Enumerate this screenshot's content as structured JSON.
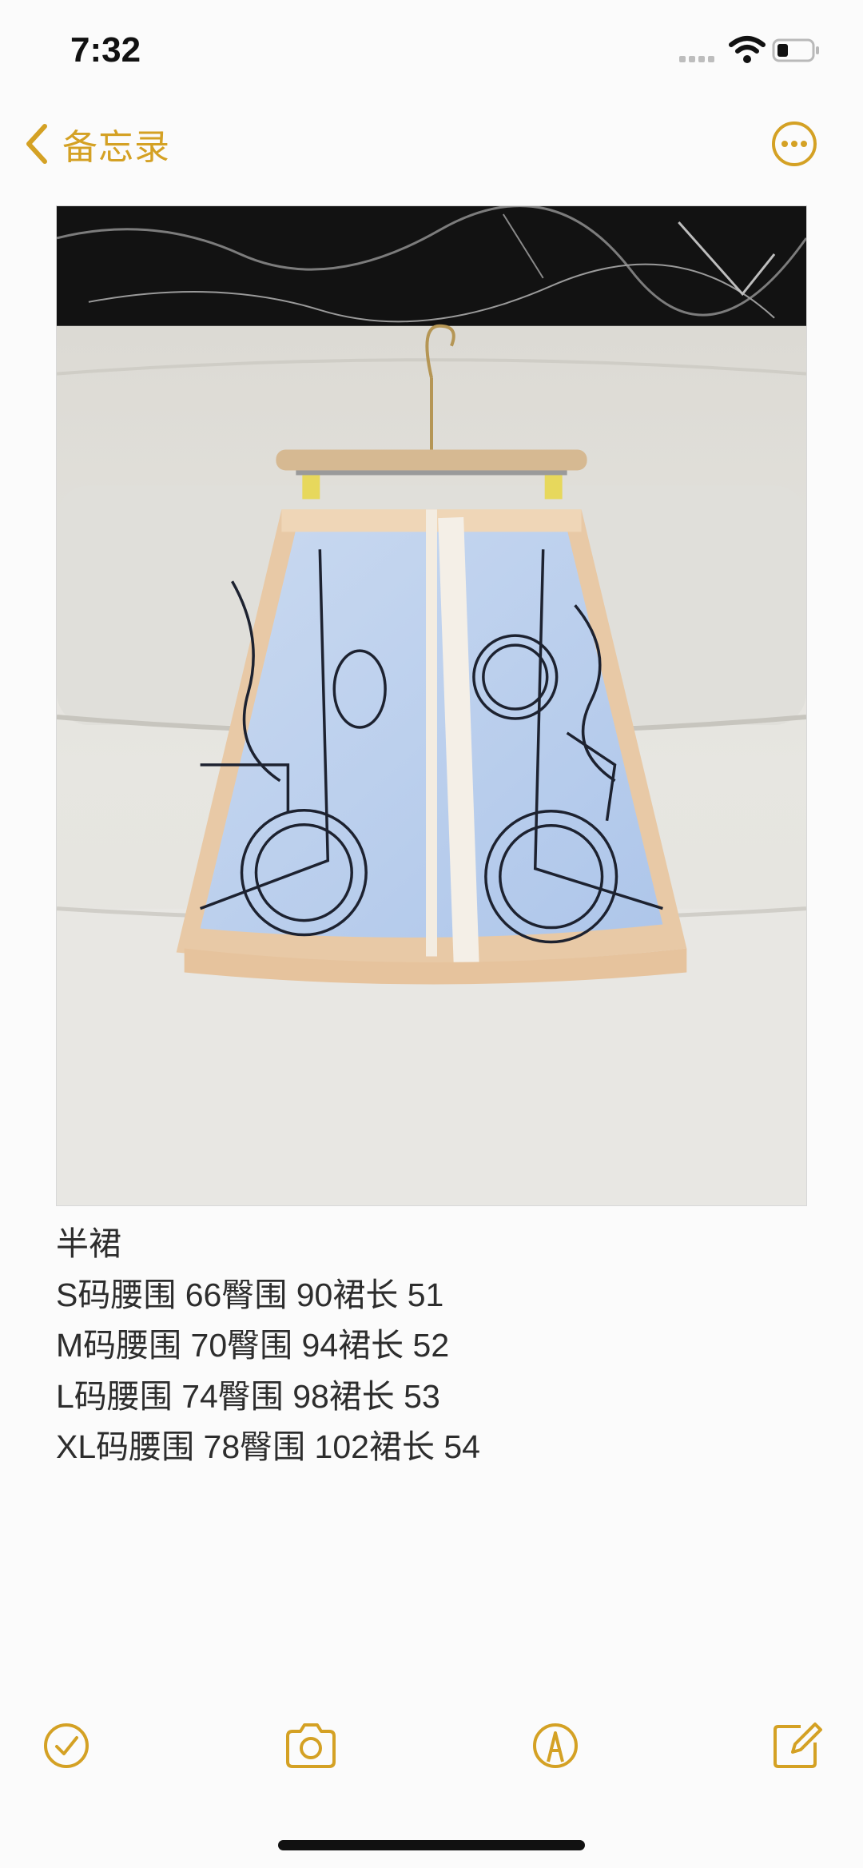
{
  "status_bar": {
    "time": "7:32"
  },
  "nav": {
    "back_label": "备忘录",
    "more_icon": "ellipsis-circle-icon"
  },
  "note": {
    "title": "半裙",
    "lines": [
      "S码腰围 66臀围 90裙长 51",
      "M码腰围 70臀围 94裙长 52",
      "L码腰围 74臀围 98裙长 53",
      "XL码腰围 78臀围 102裙长 54"
    ]
  },
  "toolbar": {
    "icons": [
      "checklist-icon",
      "camera-icon",
      "markup-pen-icon",
      "compose-icon"
    ]
  },
  "colors": {
    "accent": "#d4a124",
    "text": "#2d2d2d",
    "background": "#fbfbfb"
  }
}
